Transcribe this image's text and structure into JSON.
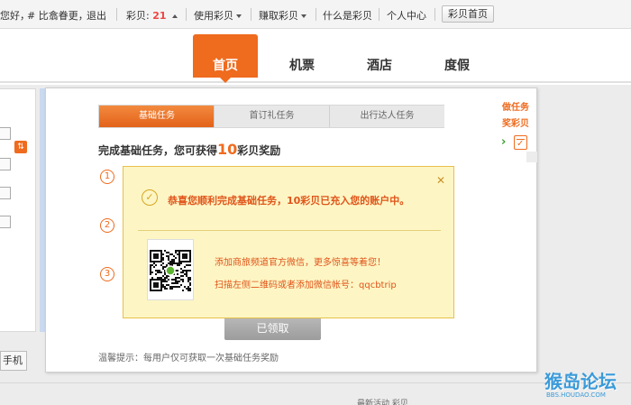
{
  "topbar": {
    "greeting": "您好，",
    "user": "# 比翕眷更，",
    "logout": "退出",
    "coins_label": "彩贝:",
    "coins_value": "21",
    "use_coins": "使用彩贝",
    "earn_coins": "赚取彩贝",
    "what_is": "什么是彩贝",
    "personal_center": "个人中心",
    "home_button": "彩贝首页"
  },
  "nav": {
    "tabs": [
      {
        "label": "首页",
        "active": true
      },
      {
        "label": "机票",
        "active": false
      },
      {
        "label": "酒店",
        "active": false
      },
      {
        "label": "度假",
        "active": false
      }
    ]
  },
  "left": {
    "phone_button": "手机"
  },
  "task": {
    "tabs": [
      {
        "label": "基础任务",
        "active": true
      },
      {
        "label": "首订礼任务",
        "active": false
      },
      {
        "label": "出行达人任务",
        "active": false
      }
    ],
    "headline_prefix": "完成基础任务，您可获得",
    "headline_number": "10",
    "headline_suffix": "彩贝奖励",
    "steps": [
      "1",
      "2",
      "3"
    ],
    "claimed_button": "已领取",
    "tip": "温馨提示：每用户仅可获取一次基础任务奖励"
  },
  "side": {
    "do_task": "做任务",
    "reward": "奖彩贝"
  },
  "popup": {
    "close": "✕",
    "message": "恭喜您顺利完成基础任务，10彩贝已充入您的账户中。",
    "line1": "添加商旅频道官方微信，更多惊喜等着您！",
    "line2": "扫描左侧二维码或者添加微信帐号：qqcbtrip"
  },
  "watermark": {
    "logo": "猴岛论坛",
    "url": "BBS.HOUDAO.COM"
  },
  "bottom": {
    "fragment": "最新活动        彩贝"
  },
  "colors": {
    "accent": "#ef6b1e",
    "popup_bg": "#fdf6c4",
    "popup_border": "#e8c04b"
  }
}
